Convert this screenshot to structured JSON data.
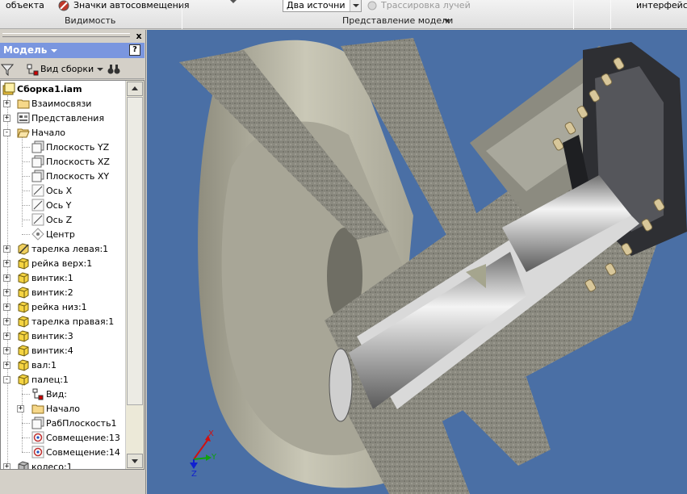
{
  "ribbon": {
    "object_label": "объекта",
    "autosnap_label": "Значки автосовмещения",
    "visibility_group": "Видимость",
    "lights_combo": "Два источни",
    "raytrace_label": "Трассировка лучей",
    "model_view_group": "Представление модели",
    "interface_label": "интерфейс"
  },
  "browser": {
    "title": "Модель",
    "help": "?",
    "close": "x",
    "view_combo": "Вид сборки",
    "root": "Сборка1.iam",
    "items": [
      {
        "label": "Взаимосвязи",
        "level": 1,
        "icon": "folder-icon",
        "expander": "+"
      },
      {
        "label": "Представления",
        "level": 1,
        "icon": "representations-icon",
        "expander": "+"
      },
      {
        "label": "Начало",
        "level": 1,
        "icon": "folder-open-icon",
        "expander": "-"
      },
      {
        "label": "Плоскость YZ",
        "level": 2,
        "icon": "plane-icon",
        "expander": ""
      },
      {
        "label": "Плоскость XZ",
        "level": 2,
        "icon": "plane-icon",
        "expander": ""
      },
      {
        "label": "Плоскость XY",
        "level": 2,
        "icon": "plane-icon",
        "expander": ""
      },
      {
        "label": "Ось X",
        "level": 2,
        "icon": "axis-icon",
        "expander": ""
      },
      {
        "label": "Ось Y",
        "level": 2,
        "icon": "axis-icon",
        "expander": ""
      },
      {
        "label": "Ось Z",
        "level": 2,
        "icon": "axis-icon",
        "expander": ""
      },
      {
        "label": "Центр",
        "level": 2,
        "icon": "center-point-icon",
        "expander": ""
      },
      {
        "label": "тарелка левая:1",
        "level": 1,
        "icon": "grounded-part-icon",
        "expander": "+"
      },
      {
        "label": "рейка верх:1",
        "level": 1,
        "icon": "part-icon",
        "expander": "+"
      },
      {
        "label": "винтик:1",
        "level": 1,
        "icon": "part-icon",
        "expander": "+"
      },
      {
        "label": "винтик:2",
        "level": 1,
        "icon": "part-icon",
        "expander": "+"
      },
      {
        "label": "рейка низ:1",
        "level": 1,
        "icon": "part-icon",
        "expander": "+"
      },
      {
        "label": "тарелка правая:1",
        "level": 1,
        "icon": "part-icon",
        "expander": "+"
      },
      {
        "label": "винтик:3",
        "level": 1,
        "icon": "part-icon",
        "expander": "+"
      },
      {
        "label": "винтик:4",
        "level": 1,
        "icon": "part-icon",
        "expander": "+"
      },
      {
        "label": "вал:1",
        "level": 1,
        "icon": "part-icon",
        "expander": "+"
      },
      {
        "label": "палец:1",
        "level": 1,
        "icon": "part-icon",
        "expander": "-"
      },
      {
        "label": "Вид:",
        "level": 2,
        "icon": "view-icon",
        "expander": ""
      },
      {
        "label": "Начало",
        "level": 2,
        "icon": "folder-icon",
        "expander": "+"
      },
      {
        "label": "РабПлоскость1",
        "level": 2,
        "icon": "workplane-icon",
        "expander": ""
      },
      {
        "label": "Совмещение:13",
        "level": 2,
        "icon": "constraint-icon",
        "expander": ""
      },
      {
        "label": "Совмещение:14",
        "level": 2,
        "icon": "constraint-icon",
        "expander": ""
      },
      {
        "label": "колесо:1",
        "level": 1,
        "icon": "part-gray-icon",
        "expander": "+"
      }
    ]
  },
  "viewport": {
    "background": "#4a6fa5",
    "triad": {
      "x_label": "X",
      "y_label": "Y",
      "z_label": "Z"
    }
  }
}
